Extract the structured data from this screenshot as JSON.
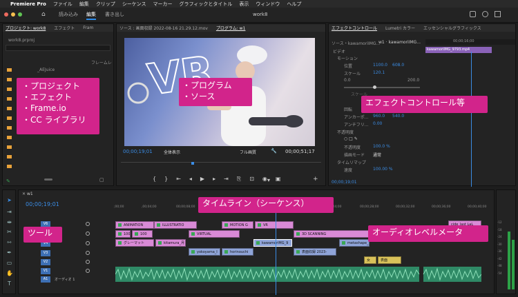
{
  "menubar": {
    "apple": "",
    "app": "Premiere Pro",
    "items": [
      "ファイル",
      "編集",
      "クリップ",
      "シーケンス",
      "マーカー",
      "グラフィックとタイトル",
      "表示",
      "ウィンドウ",
      "ヘルプ"
    ]
  },
  "workspace": {
    "tabs": [
      "読み込み",
      "編集",
      "書き出し"
    ],
    "active": 1,
    "project_name": "work8"
  },
  "project_panel": {
    "tabs": [
      "プロジェクト: work8",
      "エフェクト",
      "Fram"
    ],
    "file": "work8.prproj",
    "col_header": "フレームレ",
    "folder": "_AEJuice"
  },
  "source_tab": "ソース : 画面収録 2022-08-16 21.29.12.mov",
  "program_tab": "プログラム: w1",
  "program": {
    "timecode": "00;00;19;01",
    "fit": "全体表示",
    "quality": "フル画質",
    "duration": "00;00;51;17",
    "overlay_text": "VR"
  },
  "effect_panel": {
    "tabs": [
      "エフェクトコントロール",
      "Lumetri カラー",
      "エッセンシャルグラフィックス"
    ],
    "source": "ソース・kawamoriIMG...",
    "clip": "w1 · kawamoriIMG...",
    "video_label": "ビデオ",
    "clip_bar": "kawamoriIMG_9793.mp4",
    "time_ruler": "00;00;16;00",
    "rows": [
      {
        "label": "モーション"
      },
      {
        "label": "位置",
        "v1": "1100.0",
        "v2": "608.0"
      },
      {
        "label": "スケール",
        "v1": "120.1"
      },
      {
        "label": "0.0",
        "v1": "200.0"
      },
      {
        "label": "スケール"
      },
      {
        "label": "回転"
      },
      {
        "label": "アンカーポ...",
        "v1": "960.0",
        "v2": "540.0"
      },
      {
        "label": "アンチフリ...",
        "v1": "0.00"
      },
      {
        "label": "不透明度"
      },
      {
        "label": "不透明度",
        "v1": "100.0 %"
      },
      {
        "label": "描画モード",
        "v1": "通常"
      },
      {
        "label": "タイムリマップ"
      },
      {
        "label": "速度",
        "v1": "100.00 %"
      }
    ],
    "footer_time": "00;00;19;01"
  },
  "timeline": {
    "sequence": "w1",
    "timecode": "00;00;19;01",
    "ruler": [
      ";00;00",
      ",00;04;00",
      "00;00;08;00",
      "00;00;12;00",
      "00;00;16;00",
      "00;00;20;00",
      "00;00;24;00",
      "00;00;28;00",
      "00;00;32;00",
      "00;00;36;00",
      "00;00;40;00"
    ],
    "tracks": [
      "V6",
      "V5",
      "V4",
      "V3",
      "V2",
      "V1",
      "A1"
    ],
    "audio_track_label": "オーディオ 1",
    "clips": [
      "ANIMATION",
      "ILLUSTRATIO",
      "MOTION G",
      "VR",
      "1000",
      "100",
      "VIRTUAL",
      "3D SCANNING",
      "グレーマット",
      "kitamura_月",
      "kawamoriMG_9",
      "metashape_",
      "yokoyama_I",
      "horinouchi",
      "表面収録 2023-",
      "女",
      "表面",
      "cide_last LaL"
    ]
  },
  "meter": {
    "labels": [
      "-12",
      "-18",
      "-24",
      "-30",
      "-36",
      "-42",
      "-48",
      "-54"
    ]
  },
  "callouts": {
    "project": [
      "・プロジェクト",
      "・エフェクト",
      "・Frame.io",
      "・CC ライブラリ"
    ],
    "program": [
      "・プログラム",
      "・ソース"
    ],
    "effect": "エフェクトコントロール等",
    "timeline": "タイムライン（シーケンス）",
    "tools": "ツール",
    "audio": "オーディオレベルメータ"
  }
}
